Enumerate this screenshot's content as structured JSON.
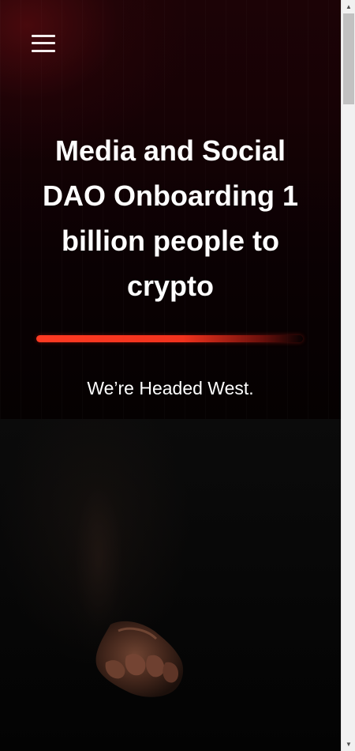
{
  "header": {
    "menu_icon": "hamburger-menu-icon",
    "menu_label": "Menu"
  },
  "hero": {
    "title": "Media and Social DAO Onboarding 1 billion people to crypto",
    "subtitle": "We’re Headed West.",
    "accent_color": "#f2321d"
  },
  "image": {
    "alt": ""
  },
  "scrollbar": {
    "up_arrow_icon": "triangle-up-icon",
    "down_arrow_icon": "triangle-down-icon"
  }
}
